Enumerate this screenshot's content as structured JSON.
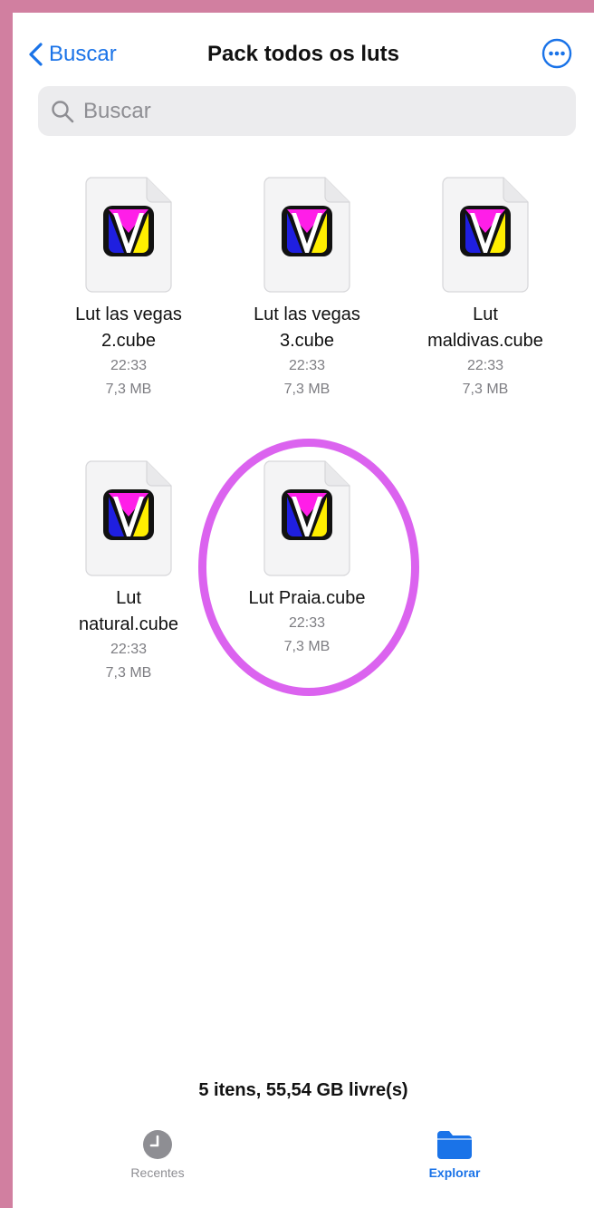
{
  "nav": {
    "back_label": "Buscar",
    "title": "Pack todos os luts",
    "more_icon": "ellipsis-circle-icon"
  },
  "search": {
    "placeholder": "Buscar",
    "icon": "search-icon"
  },
  "files": [
    {
      "name_line1": "Lut las vegas",
      "name_line2": "2.cube",
      "time": "22:33",
      "size": "7,3 MB"
    },
    {
      "name_line1": "Lut las vegas",
      "name_line2": "3.cube",
      "time": "22:33",
      "size": "7,3 MB"
    },
    {
      "name_line1": "Lut",
      "name_line2": "maldivas.cube",
      "time": "22:33",
      "size": "7,3 MB"
    },
    {
      "name_line1": "Lut",
      "name_line2": "natural.cube",
      "time": "22:33",
      "size": "7,3 MB"
    },
    {
      "name_line1": "Lut Praia.cube",
      "name_line2": "",
      "time": "22:33",
      "size": "7,3 MB"
    }
  ],
  "footer": {
    "summary": "5 itens, 55,54 GB livre(s)"
  },
  "tabs": [
    {
      "label": "Recentes",
      "icon": "clock-icon",
      "active": false
    },
    {
      "label": "Explorar",
      "icon": "folder-icon",
      "active": true
    }
  ],
  "colors": {
    "accent": "#1a73e8",
    "background": "#d17fa0",
    "highlight": "#db63ef",
    "logo_magenta": "#ff1ee8",
    "logo_blue": "#1f1fe0",
    "logo_yellow": "#ffee00"
  }
}
